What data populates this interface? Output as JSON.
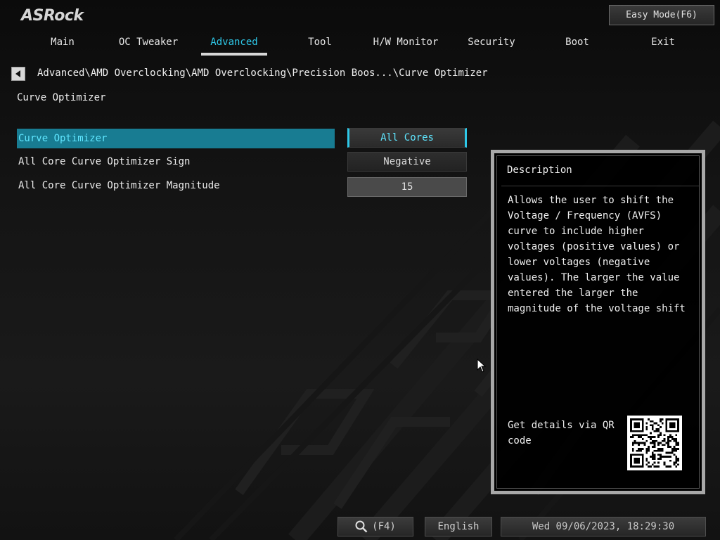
{
  "app": {
    "logo": "ASRock",
    "easy_mode": "Easy Mode(F6)"
  },
  "tabs": [
    {
      "label": "Main"
    },
    {
      "label": "OC Tweaker"
    },
    {
      "label": "Advanced"
    },
    {
      "label": "Tool"
    },
    {
      "label": "H/W Monitor"
    },
    {
      "label": "Security"
    },
    {
      "label": "Boot"
    },
    {
      "label": "Exit"
    }
  ],
  "active_tab": "Advanced",
  "breadcrumb": "Advanced\\AMD Overclocking\\AMD Overclocking\\Precision Boos...\\Curve Optimizer",
  "page_title": "Curve Optimizer",
  "settings": [
    {
      "label": "Curve Optimizer",
      "value": "All Cores"
    },
    {
      "label": "All Core Curve Optimizer Sign",
      "value": "Negative"
    },
    {
      "label": "All Core Curve Optimizer Magnitude",
      "value": "15"
    }
  ],
  "description": {
    "title": "Description",
    "text": "Allows the user to shift the\nVoltage / Frequency (AVFS)\ncurve to include higher\nvoltages (positive values) or\nlower voltages (negative\nvalues). The larger the value\nentered the larger the\nmagnitude of the voltage shift",
    "qr_label": "Get details via QR code"
  },
  "bottom": {
    "search_key": "(F4)",
    "language": "English",
    "datetime": "Wed 09/06/2023, 18:29:30"
  },
  "colors": {
    "accent": "#2ec8e8",
    "selected_bg": "#187c92",
    "selected_text": "#5fe6ff"
  }
}
